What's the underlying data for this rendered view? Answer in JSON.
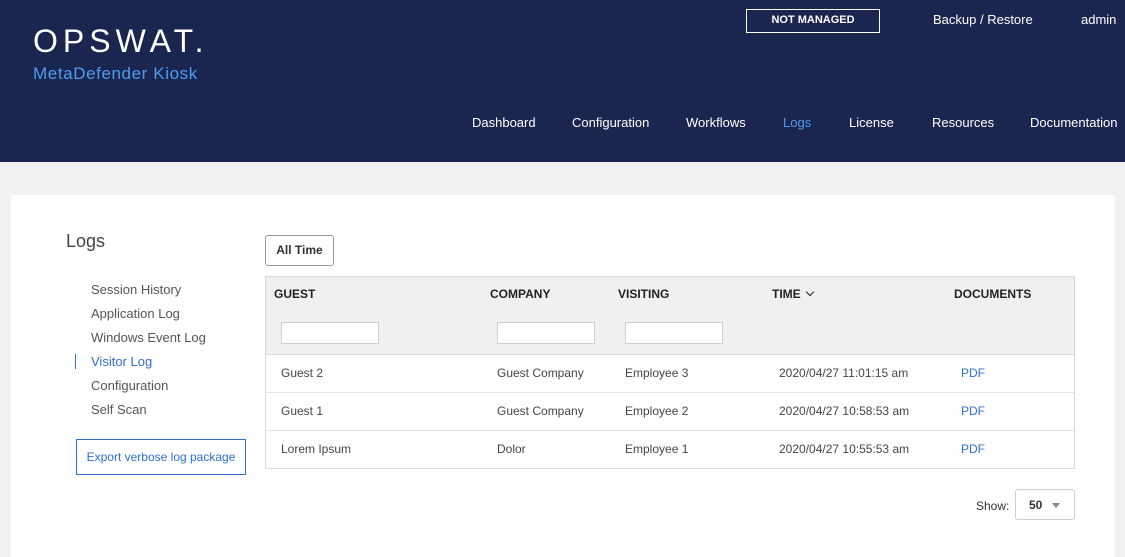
{
  "header": {
    "logo": "OPSWAT.",
    "product": "MetaDefender Kiosk",
    "status_badge": "NOT MANAGED",
    "backup_restore": "Backup / Restore",
    "user": "admin",
    "nav": [
      "Dashboard",
      "Configuration",
      "Workflows",
      "Logs",
      "License",
      "Resources",
      "Documentation"
    ],
    "active_nav": "Logs"
  },
  "sidebar": {
    "title": "Logs",
    "items": [
      "Session History",
      "Application Log",
      "Windows Event Log",
      "Visitor Log",
      "Configuration",
      "Self Scan"
    ],
    "active_item": "Visitor Log",
    "export_button": "Export verbose log package"
  },
  "filter": {
    "time_range": "All Time"
  },
  "table": {
    "columns": [
      "GUEST",
      "COMPANY",
      "VISITING",
      "TIME",
      "DOCUMENTS"
    ],
    "sort_column": "TIME",
    "sort_direction": "descending",
    "filters": {
      "guest": "",
      "company": "",
      "visiting": ""
    },
    "rows": [
      {
        "guest": "Guest 2",
        "company": "Guest Company",
        "visiting": "Employee 3",
        "time": "2020/04/27 11:01:15 am",
        "documents": "PDF"
      },
      {
        "guest": "Guest 1",
        "company": "Guest Company",
        "visiting": "Employee 2",
        "time": "2020/04/27 10:58:53 am",
        "documents": "PDF"
      },
      {
        "guest": "Lorem Ipsum",
        "company": "Dolor",
        "visiting": "Employee 1",
        "time": "2020/04/27 10:55:53 am",
        "documents": "PDF"
      }
    ]
  },
  "pagination": {
    "show_label": "Show:",
    "page_size": "50"
  },
  "colors": {
    "header_bg": "#1a2650",
    "accent": "#4d9cf0",
    "link": "#2f6fd0"
  }
}
